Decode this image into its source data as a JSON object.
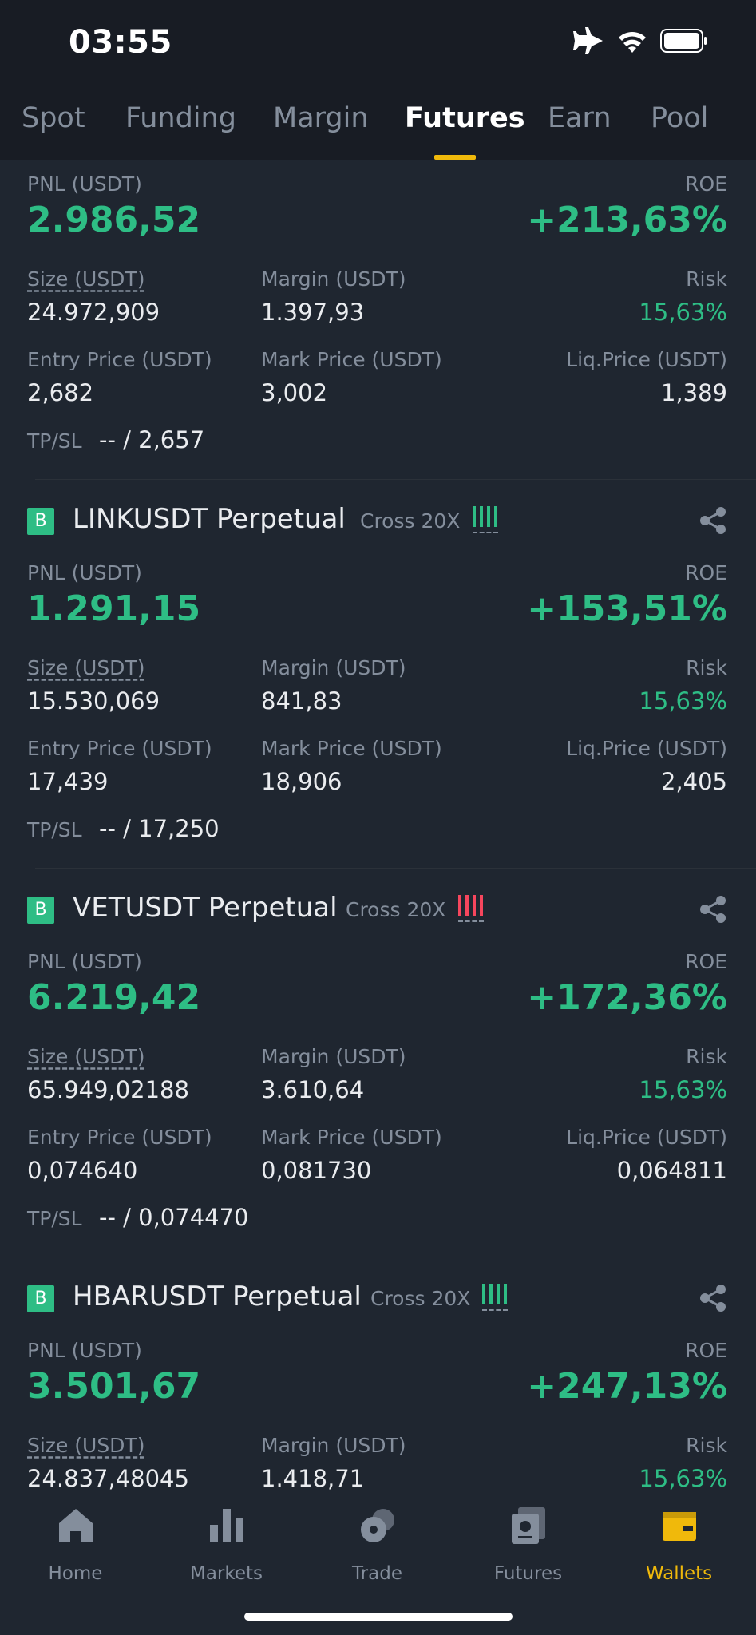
{
  "status_bar": {
    "time": "03:55"
  },
  "tabs": [
    {
      "label": "Spot"
    },
    {
      "label": "Funding"
    },
    {
      "label": "Margin"
    },
    {
      "label": "Futures",
      "active": true
    },
    {
      "label": "Earn"
    },
    {
      "label": "Pool"
    }
  ],
  "labels": {
    "pnl": "PNL (USDT)",
    "roe": "ROE",
    "size": "Size (USDT)",
    "margin": "Margin (USDT)",
    "risk": "Risk",
    "entry": "Entry Price (USDT)",
    "mark": "Mark Price (USDT)",
    "liq": "Liq.Price (USDT)",
    "tpsl": "TP/SL",
    "badge": "B",
    "cross": "Cross 20X"
  },
  "positions": [
    {
      "pnl": "2.986,52",
      "roe": "+213,63%",
      "size": "24.972,909",
      "margin": "1.397,93",
      "risk": "15,63%",
      "entry": "2,682",
      "mark": "3,002",
      "liq": "1,389",
      "tpsl": "-- / 2,657"
    },
    {
      "symbol": "LINKUSDT Perpetual",
      "bar_color": "#2ebd85",
      "pnl": "1.291,15",
      "roe": "+153,51%",
      "size": "15.530,069",
      "margin": "841,83",
      "risk": "15,63%",
      "entry": "17,439",
      "mark": "18,906",
      "liq": "2,405",
      "tpsl": "-- / 17,250"
    },
    {
      "symbol": "VETUSDT Perpetual",
      "bar_color": "#f6465d",
      "pnl": "6.219,42",
      "roe": "+172,36%",
      "size": "65.949,02188",
      "margin": "3.610,64",
      "risk": "15,63%",
      "entry": "0,074640",
      "mark": "0,081730",
      "liq": "0,064811",
      "tpsl": "-- / 0,074470"
    },
    {
      "symbol": "HBARUSDT Perpetual",
      "bar_color": "#2ebd85",
      "pnl": "3.501,67",
      "roe": "+247,13%",
      "size": "24.837,48045",
      "margin": "1.418,71",
      "risk": "15,63%"
    }
  ],
  "bottom_nav": [
    {
      "label": "Home",
      "icon": "home-icon"
    },
    {
      "label": "Markets",
      "icon": "markets-icon"
    },
    {
      "label": "Trade",
      "icon": "trade-icon"
    },
    {
      "label": "Futures",
      "icon": "futures-icon"
    },
    {
      "label": "Wallets",
      "icon": "wallet-icon",
      "active": true
    }
  ],
  "colors": {
    "accent": "#f0b90b",
    "positive": "#2ebd85",
    "negative": "#f6465d",
    "background": "#1f2630"
  }
}
